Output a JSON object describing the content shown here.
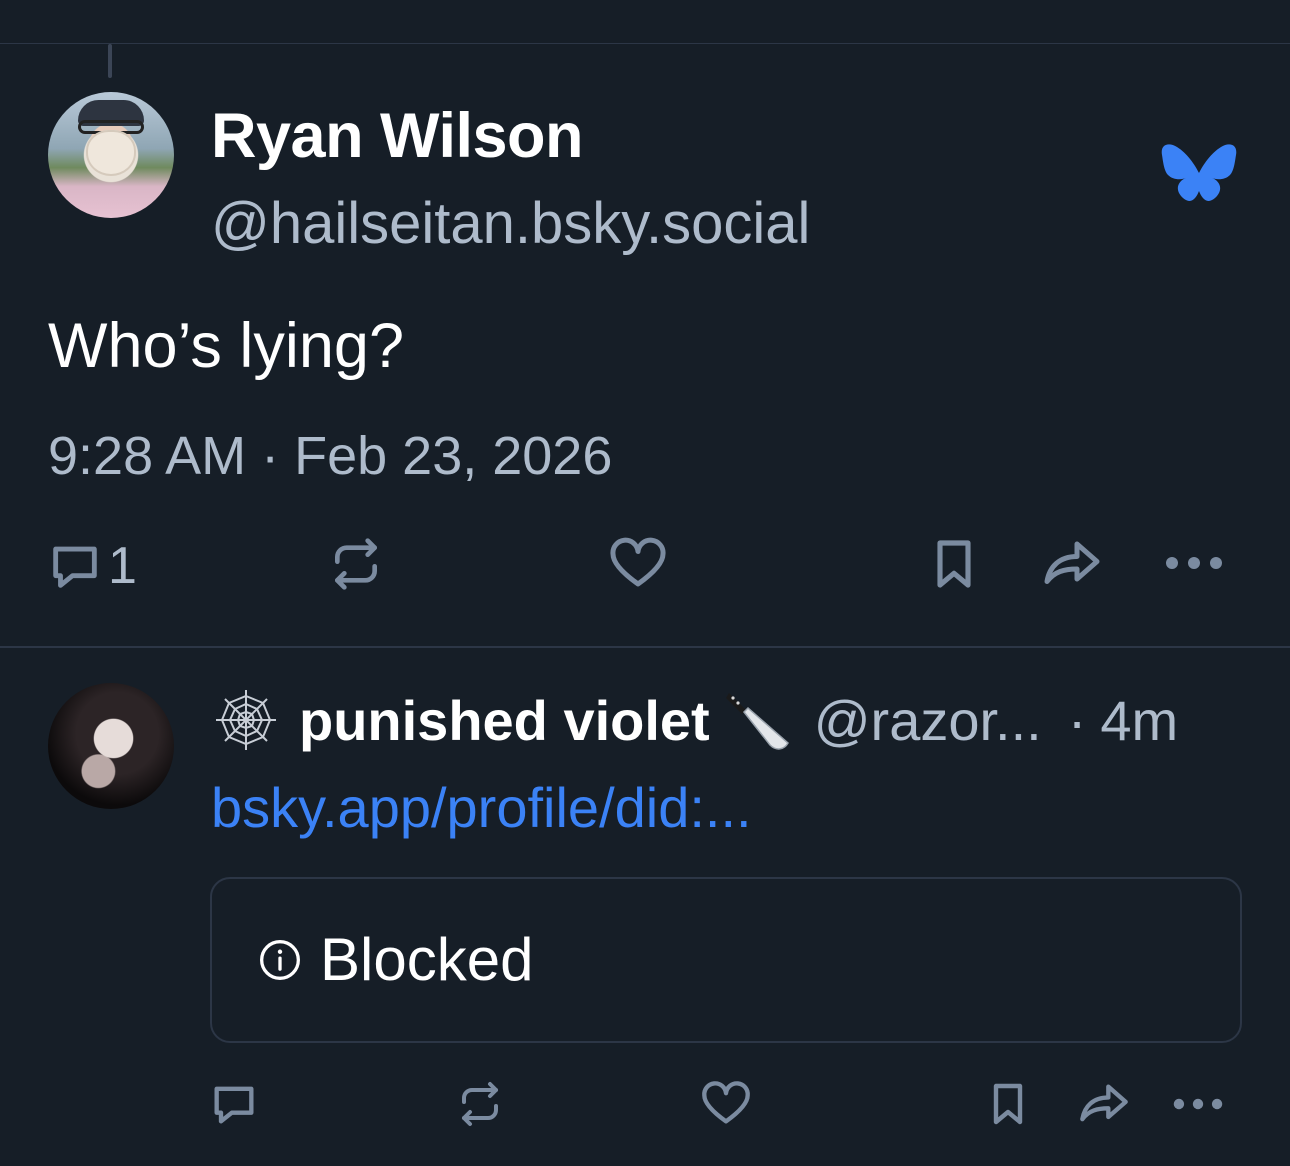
{
  "thread": {
    "main_post": {
      "author_name": "Ryan Wilson",
      "author_handle": "@hailseitan.bsky.social",
      "text": "Who’s lying?",
      "timestamp": "9:28 AM · Feb 23, 2026",
      "reply_count": "1",
      "brand_icon": "bluesky-butterfly-icon",
      "actions": [
        "reply",
        "repost",
        "like",
        "bookmark",
        "share",
        "more"
      ]
    },
    "reply_post": {
      "author_name": "punished violet",
      "author_handle": "@razor...",
      "separator": "·",
      "age": "4m",
      "link_text": "bsky.app/profile/did:...",
      "embed_status": "Blocked",
      "name_prefix_icon": "spider-web-icon",
      "name_suffix_icon": "knife-icon",
      "actions": [
        "reply",
        "repost",
        "like",
        "bookmark",
        "share",
        "more"
      ]
    }
  },
  "colors": {
    "background": "#161e27",
    "accent": "#3b82f6",
    "muted_text": "#aebbcb",
    "icon": "#7b8ba0",
    "divider": "#2c3646"
  }
}
